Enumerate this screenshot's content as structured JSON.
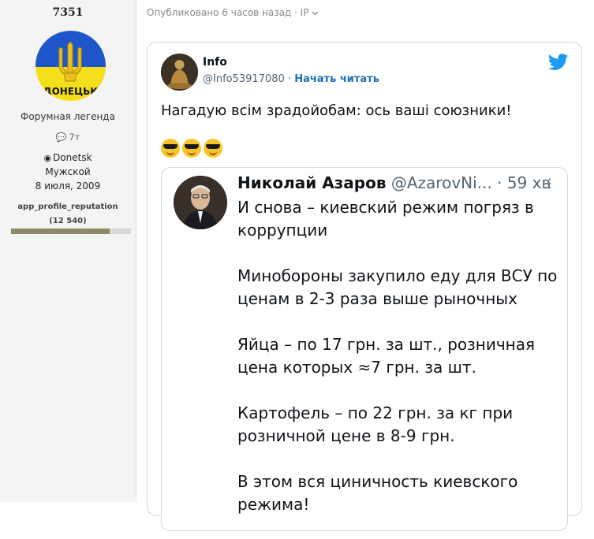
{
  "profile": {
    "username": "7351",
    "avatar_text": "ДОНЕЦЬК",
    "role": "Форумная легенда",
    "messages": "7т",
    "location": "Donetsk",
    "gender": "Мужской",
    "joined": "8 июля, 2009",
    "reputation_label": "app_profile_reputation",
    "reputation_value": "(12 540)",
    "reputation_fill": 0.82
  },
  "post": {
    "meta": "Опубликовано 6 часов назад · IP",
    "chevron_icon": "chevron-down-icon"
  },
  "tweet": {
    "author_name": "Info",
    "author_handle": "@Info53917080",
    "separator": "·",
    "follow_label": "Начать читать",
    "text": "Нагадую всім зрадойобам: ось ваші союзники!",
    "emoji_count": 3,
    "brand_color": "#1d9bf0",
    "quote": {
      "name": "Николай Азаров",
      "handle": "@AzarovNi...",
      "separator": "·",
      "time": "59 хв",
      "paragraphs": [
        "И снова – киевский режим погряз в коррупции",
        "Минобороны закупило еду для ВСУ по ценам в 2-3 раза выше рыночных",
        "Яйца – по 17 грн. за шт., розничная цена которых ≈7 грн. за шт.",
        "Картофель – по 22 грн. за кг при розничной цене в 8-9 грн.",
        "В этом вся циничность киевского режима!"
      ]
    }
  }
}
